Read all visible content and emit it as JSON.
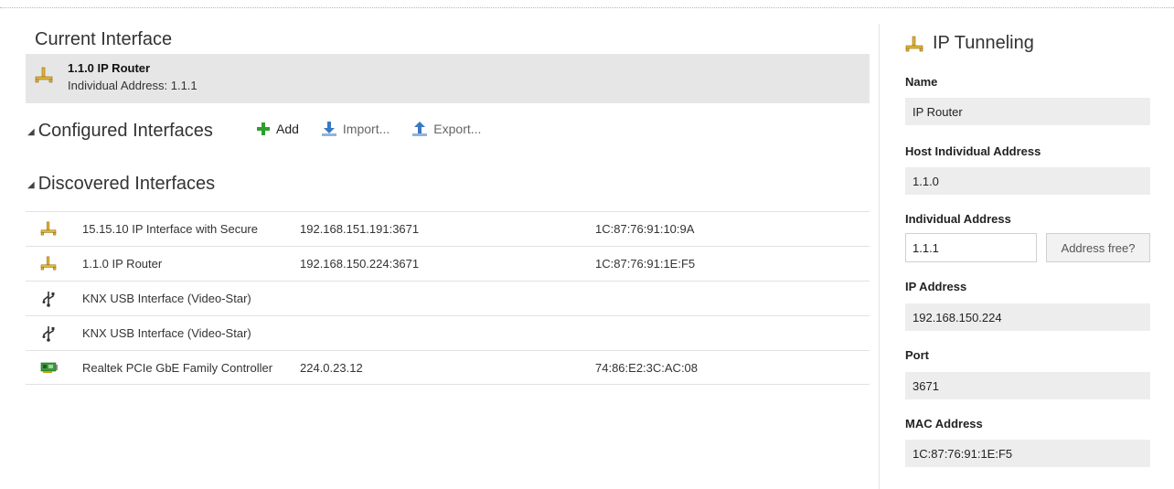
{
  "current_interface": {
    "title": "Current Interface",
    "name": "1.1.0 IP Router",
    "address": "Individual Address: 1.1.1"
  },
  "configured": {
    "title": "Configured Interfaces",
    "add_label": "Add",
    "import_label": "Import...",
    "export_label": "Export..."
  },
  "discovered": {
    "title": "Discovered Interfaces",
    "rows": [
      {
        "icon": "network-icon",
        "name": "15.15.10 IP Interface with Secure",
        "ip": "192.168.151.191:3671",
        "mac": "1C:87:76:91:10:9A"
      },
      {
        "icon": "network-icon",
        "name": "1.1.0 IP Router",
        "ip": "192.168.150.224:3671",
        "mac": "1C:87:76:91:1E:F5"
      },
      {
        "icon": "usb-icon",
        "name": "KNX USB Interface (Video-Star)",
        "ip": "",
        "mac": ""
      },
      {
        "icon": "usb-icon",
        "name": "KNX USB Interface (Video-Star)",
        "ip": "",
        "mac": ""
      },
      {
        "icon": "network-card-icon",
        "name": "Realtek PCIe GbE Family Controller",
        "ip": "224.0.23.12",
        "mac": "74:86:E2:3C:AC:08"
      }
    ]
  },
  "details": {
    "title": "IP Tunneling",
    "name_label": "Name",
    "name_value": "IP Router",
    "host_label": "Host Individual Address",
    "host_value": "1.1.0",
    "ia_label": "Individual Address",
    "ia_value": "1.1.1",
    "address_free_label": "Address free?",
    "ip_label": "IP Address",
    "ip_value": "192.168.150.224",
    "port_label": "Port",
    "port_value": "3671",
    "mac_label": "MAC Address",
    "mac_value": "1C:87:76:91:1E:F5"
  },
  "colors": {
    "add_green": "#2e9e2e",
    "import_blue": "#3a78c2",
    "export_blue": "#3a78c2",
    "network_icon_yellow": "#e3b53a",
    "nic_green": "#3b9a3b"
  }
}
